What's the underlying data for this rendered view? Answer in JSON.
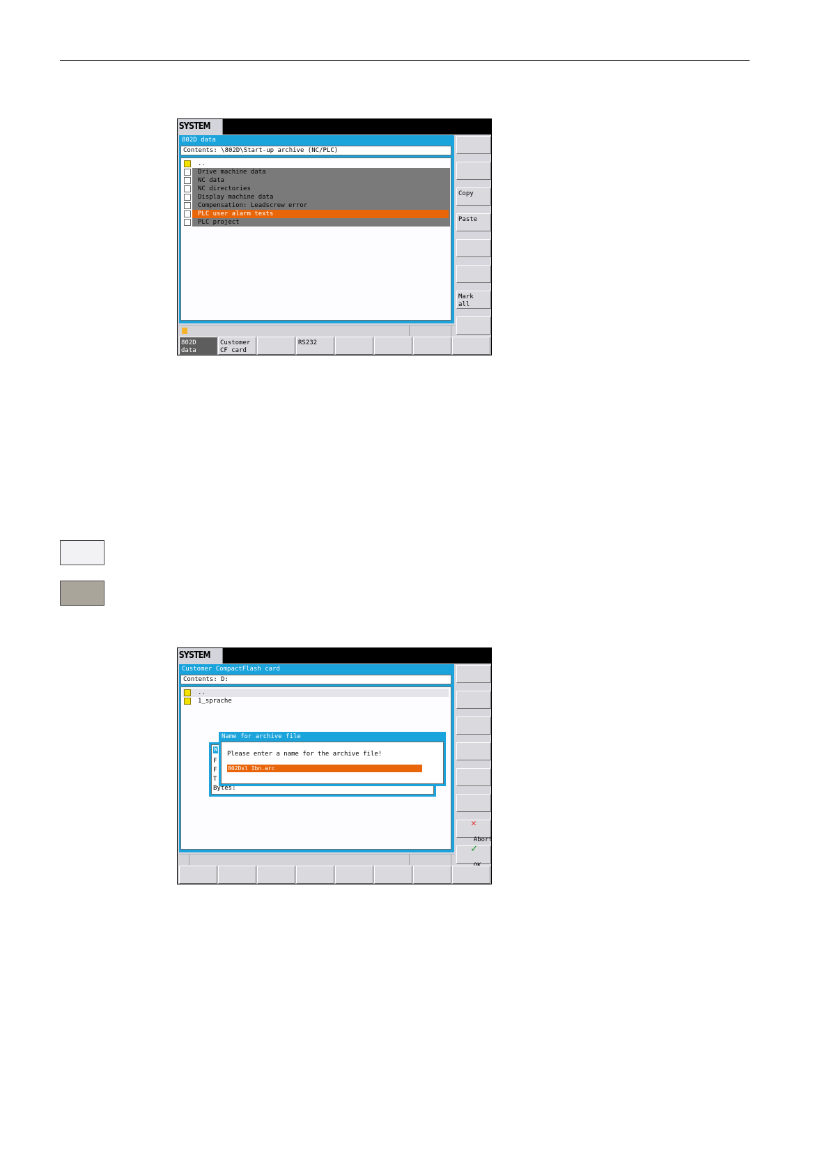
{
  "screen1": {
    "system_label": "SYSTEM",
    "window_title": "802D data",
    "path": "Contents: \\802D\\Start-up archive (NC/PLC)",
    "items": [
      {
        "label": "..",
        "icon": "folder-up-icon"
      },
      {
        "label": "Drive machine data",
        "icon": "file-icon"
      },
      {
        "label": "NC data",
        "icon": "file-icon"
      },
      {
        "label": "NC directories",
        "icon": "file-icon"
      },
      {
        "label": "Display machine data",
        "icon": "file-icon"
      },
      {
        "label": "Compensation: Leadscrew error",
        "icon": "file-icon"
      },
      {
        "label": "PLC user alarm texts",
        "icon": "file-icon",
        "selected": true
      },
      {
        "label": "PLC project",
        "icon": "file-icon"
      }
    ],
    "vertical_softkeys": [
      "",
      "",
      "Copy",
      "Paste",
      "",
      "",
      "Mark\nall",
      ""
    ],
    "horizontal_softkeys": [
      "802D\ndata",
      "Customer\nCF card",
      "",
      "RS232",
      "",
      "",
      "",
      ""
    ],
    "active_horizontal_softkey": "802D\ndata"
  },
  "keys": {
    "light_key_color": "#f2f2f4",
    "dark_key_color": "#aaa59a"
  },
  "screen2": {
    "system_label": "SYSTEM",
    "window_title": "Customer CompactFlash card",
    "path": "Contents: D:",
    "items": [
      {
        "label": "..",
        "icon": "folder-up-icon"
      },
      {
        "label": "1_sprache",
        "icon": "folder-icon"
      }
    ],
    "background_dialog": {
      "title": "W",
      "rows": [
        "F",
        "F",
        "T"
      ],
      "bytes_label": "Bytes:"
    },
    "dialog": {
      "title": "Name for archive file",
      "prompt": "Please enter a name for the archive file!",
      "value": "802Dsl Ibn.arc"
    },
    "vertical_softkeys": [
      "",
      "",
      "",
      "",
      "",
      "",
      "Abort",
      "OK"
    ],
    "horizontal_softkeys": [
      "",
      "",
      "",
      "",
      "",
      "",
      "",
      ""
    ]
  },
  "colors": {
    "window_blue": "#1ba3dc",
    "selection_orange": "#e8650a",
    "list_gray": "#7a7a7a",
    "abort_red": "#e0302a",
    "ok_green": "#1a9a2a"
  }
}
